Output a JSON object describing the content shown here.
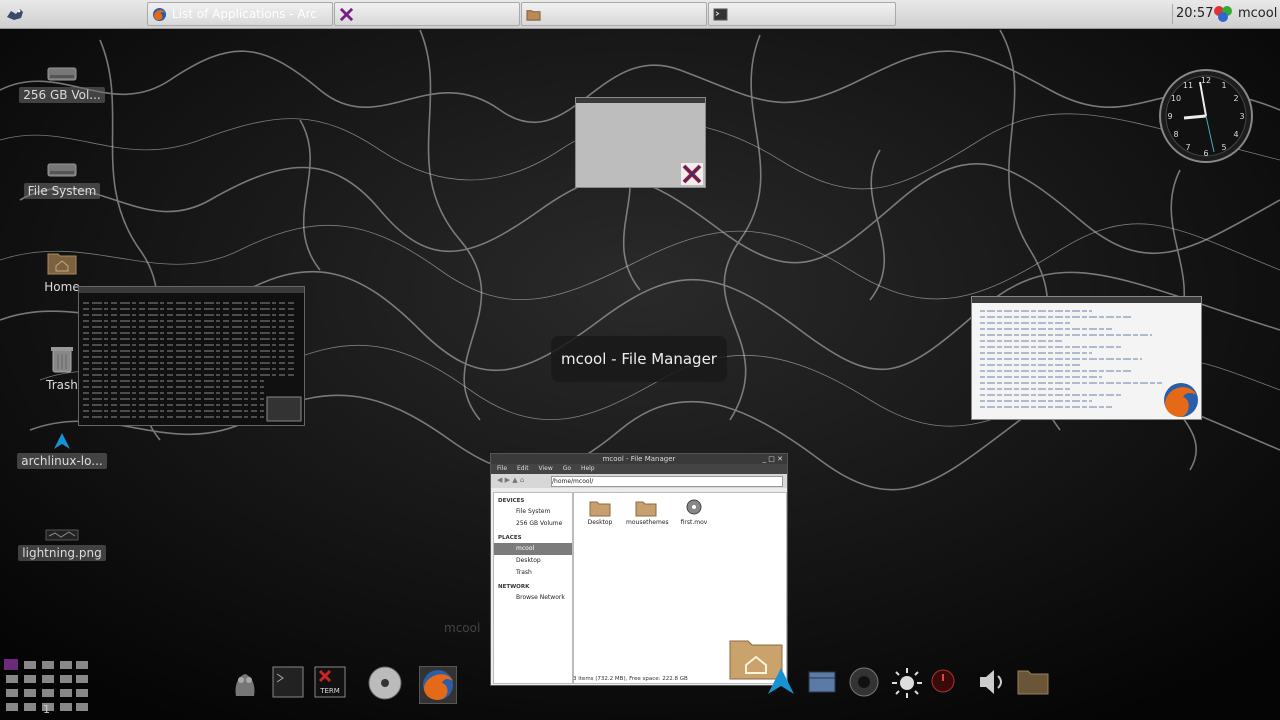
{
  "taskbar": {
    "tasks": [
      {
        "label": "List of Applications - Arc",
        "icon": "firefox-icon"
      },
      {
        "label": "",
        "icon": "xterm-x-icon"
      },
      {
        "label": "",
        "icon": "folder-icon"
      },
      {
        "label": "",
        "icon": "terminal-icon"
      }
    ],
    "clock": "20:57",
    "user": "mcool"
  },
  "desktop_icons": [
    {
      "label": "256 GB Vol...",
      "icon": "drive-icon"
    },
    {
      "label": "File System",
      "icon": "drive-icon"
    },
    {
      "label": "Home",
      "icon": "home-folder-icon"
    },
    {
      "label": "Trash",
      "icon": "trash-icon"
    },
    {
      "label": "archlinux-lo...",
      "icon": "arch-logo-icon"
    },
    {
      "label": "lightning.png",
      "icon": "image-icon"
    }
  ],
  "switcher": {
    "selected_title": "mcool - File Manager"
  },
  "file_manager": {
    "title": "mcool - File Manager",
    "menu": [
      "File",
      "Edit",
      "View",
      "Go",
      "Help"
    ],
    "path": "/home/mcool/",
    "devices_header": "DEVICES",
    "devices": [
      "File System",
      "256 GB Volume"
    ],
    "places_header": "PLACES",
    "places": [
      "mcool",
      "Desktop",
      "Trash"
    ],
    "network_header": "NETWORK",
    "network": [
      "Browse Network"
    ],
    "files": [
      {
        "name": "Desktop",
        "icon": "folder-icon"
      },
      {
        "name": "mousethemes",
        "icon": "folder-icon"
      },
      {
        "name": "first.mov",
        "icon": "video-file-icon"
      }
    ],
    "status": "3 items (732.2 MB), Free space: 222.8 GB"
  },
  "ghost_label": "mcool",
  "pager_number": "1",
  "colors": {
    "panel": "#d8d8d8",
    "overlay": "#191919"
  }
}
